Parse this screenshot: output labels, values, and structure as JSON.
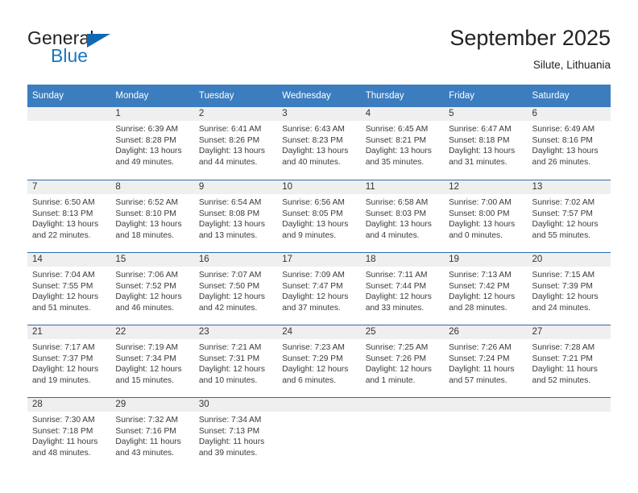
{
  "brand": {
    "name_part1": "General",
    "name_part2": "Blue",
    "triangle_icon": "triangle-icon",
    "colors": {
      "dark": "#231f20",
      "blue": "#1b75bc"
    }
  },
  "header": {
    "title": "September 2025",
    "subtitle": "Silute, Lithuania"
  },
  "theme": {
    "header_bg": "#3b7dbf",
    "row_rule": "#2b6cad",
    "daynum_band": "#efefef"
  },
  "weekdays": [
    "Sunday",
    "Monday",
    "Tuesday",
    "Wednesday",
    "Thursday",
    "Friday",
    "Saturday"
  ],
  "weeks": [
    [
      {
        "day": "",
        "blank": true,
        "sunrise": "",
        "sunset": "",
        "daylight1": "",
        "daylight2": ""
      },
      {
        "day": "1",
        "blank": false,
        "sunrise": "Sunrise: 6:39 AM",
        "sunset": "Sunset: 8:28 PM",
        "daylight1": "Daylight: 13 hours",
        "daylight2": "and 49 minutes."
      },
      {
        "day": "2",
        "blank": false,
        "sunrise": "Sunrise: 6:41 AM",
        "sunset": "Sunset: 8:26 PM",
        "daylight1": "Daylight: 13 hours",
        "daylight2": "and 44 minutes."
      },
      {
        "day": "3",
        "blank": false,
        "sunrise": "Sunrise: 6:43 AM",
        "sunset": "Sunset: 8:23 PM",
        "daylight1": "Daylight: 13 hours",
        "daylight2": "and 40 minutes."
      },
      {
        "day": "4",
        "blank": false,
        "sunrise": "Sunrise: 6:45 AM",
        "sunset": "Sunset: 8:21 PM",
        "daylight1": "Daylight: 13 hours",
        "daylight2": "and 35 minutes."
      },
      {
        "day": "5",
        "blank": false,
        "sunrise": "Sunrise: 6:47 AM",
        "sunset": "Sunset: 8:18 PM",
        "daylight1": "Daylight: 13 hours",
        "daylight2": "and 31 minutes."
      },
      {
        "day": "6",
        "blank": false,
        "sunrise": "Sunrise: 6:49 AM",
        "sunset": "Sunset: 8:16 PM",
        "daylight1": "Daylight: 13 hours",
        "daylight2": "and 26 minutes."
      }
    ],
    [
      {
        "day": "7",
        "blank": false,
        "sunrise": "Sunrise: 6:50 AM",
        "sunset": "Sunset: 8:13 PM",
        "daylight1": "Daylight: 13 hours",
        "daylight2": "and 22 minutes."
      },
      {
        "day": "8",
        "blank": false,
        "sunrise": "Sunrise: 6:52 AM",
        "sunset": "Sunset: 8:10 PM",
        "daylight1": "Daylight: 13 hours",
        "daylight2": "and 18 minutes."
      },
      {
        "day": "9",
        "blank": false,
        "sunrise": "Sunrise: 6:54 AM",
        "sunset": "Sunset: 8:08 PM",
        "daylight1": "Daylight: 13 hours",
        "daylight2": "and 13 minutes."
      },
      {
        "day": "10",
        "blank": false,
        "sunrise": "Sunrise: 6:56 AM",
        "sunset": "Sunset: 8:05 PM",
        "daylight1": "Daylight: 13 hours",
        "daylight2": "and 9 minutes."
      },
      {
        "day": "11",
        "blank": false,
        "sunrise": "Sunrise: 6:58 AM",
        "sunset": "Sunset: 8:03 PM",
        "daylight1": "Daylight: 13 hours",
        "daylight2": "and 4 minutes."
      },
      {
        "day": "12",
        "blank": false,
        "sunrise": "Sunrise: 7:00 AM",
        "sunset": "Sunset: 8:00 PM",
        "daylight1": "Daylight: 13 hours",
        "daylight2": "and 0 minutes."
      },
      {
        "day": "13",
        "blank": false,
        "sunrise": "Sunrise: 7:02 AM",
        "sunset": "Sunset: 7:57 PM",
        "daylight1": "Daylight: 12 hours",
        "daylight2": "and 55 minutes."
      }
    ],
    [
      {
        "day": "14",
        "blank": false,
        "sunrise": "Sunrise: 7:04 AM",
        "sunset": "Sunset: 7:55 PM",
        "daylight1": "Daylight: 12 hours",
        "daylight2": "and 51 minutes."
      },
      {
        "day": "15",
        "blank": false,
        "sunrise": "Sunrise: 7:06 AM",
        "sunset": "Sunset: 7:52 PM",
        "daylight1": "Daylight: 12 hours",
        "daylight2": "and 46 minutes."
      },
      {
        "day": "16",
        "blank": false,
        "sunrise": "Sunrise: 7:07 AM",
        "sunset": "Sunset: 7:50 PM",
        "daylight1": "Daylight: 12 hours",
        "daylight2": "and 42 minutes."
      },
      {
        "day": "17",
        "blank": false,
        "sunrise": "Sunrise: 7:09 AM",
        "sunset": "Sunset: 7:47 PM",
        "daylight1": "Daylight: 12 hours",
        "daylight2": "and 37 minutes."
      },
      {
        "day": "18",
        "blank": false,
        "sunrise": "Sunrise: 7:11 AM",
        "sunset": "Sunset: 7:44 PM",
        "daylight1": "Daylight: 12 hours",
        "daylight2": "and 33 minutes."
      },
      {
        "day": "19",
        "blank": false,
        "sunrise": "Sunrise: 7:13 AM",
        "sunset": "Sunset: 7:42 PM",
        "daylight1": "Daylight: 12 hours",
        "daylight2": "and 28 minutes."
      },
      {
        "day": "20",
        "blank": false,
        "sunrise": "Sunrise: 7:15 AM",
        "sunset": "Sunset: 7:39 PM",
        "daylight1": "Daylight: 12 hours",
        "daylight2": "and 24 minutes."
      }
    ],
    [
      {
        "day": "21",
        "blank": false,
        "sunrise": "Sunrise: 7:17 AM",
        "sunset": "Sunset: 7:37 PM",
        "daylight1": "Daylight: 12 hours",
        "daylight2": "and 19 minutes."
      },
      {
        "day": "22",
        "blank": false,
        "sunrise": "Sunrise: 7:19 AM",
        "sunset": "Sunset: 7:34 PM",
        "daylight1": "Daylight: 12 hours",
        "daylight2": "and 15 minutes."
      },
      {
        "day": "23",
        "blank": false,
        "sunrise": "Sunrise: 7:21 AM",
        "sunset": "Sunset: 7:31 PM",
        "daylight1": "Daylight: 12 hours",
        "daylight2": "and 10 minutes."
      },
      {
        "day": "24",
        "blank": false,
        "sunrise": "Sunrise: 7:23 AM",
        "sunset": "Sunset: 7:29 PM",
        "daylight1": "Daylight: 12 hours",
        "daylight2": "and 6 minutes."
      },
      {
        "day": "25",
        "blank": false,
        "sunrise": "Sunrise: 7:25 AM",
        "sunset": "Sunset: 7:26 PM",
        "daylight1": "Daylight: 12 hours",
        "daylight2": "and 1 minute."
      },
      {
        "day": "26",
        "blank": false,
        "sunrise": "Sunrise: 7:26 AM",
        "sunset": "Sunset: 7:24 PM",
        "daylight1": "Daylight: 11 hours",
        "daylight2": "and 57 minutes."
      },
      {
        "day": "27",
        "blank": false,
        "sunrise": "Sunrise: 7:28 AM",
        "sunset": "Sunset: 7:21 PM",
        "daylight1": "Daylight: 11 hours",
        "daylight2": "and 52 minutes."
      }
    ],
    [
      {
        "day": "28",
        "blank": false,
        "sunrise": "Sunrise: 7:30 AM",
        "sunset": "Sunset: 7:18 PM",
        "daylight1": "Daylight: 11 hours",
        "daylight2": "and 48 minutes."
      },
      {
        "day": "29",
        "blank": false,
        "sunrise": "Sunrise: 7:32 AM",
        "sunset": "Sunset: 7:16 PM",
        "daylight1": "Daylight: 11 hours",
        "daylight2": "and 43 minutes."
      },
      {
        "day": "30",
        "blank": false,
        "sunrise": "Sunrise: 7:34 AM",
        "sunset": "Sunset: 7:13 PM",
        "daylight1": "Daylight: 11 hours",
        "daylight2": "and 39 minutes."
      },
      {
        "day": "",
        "blank": true,
        "sunrise": "",
        "sunset": "",
        "daylight1": "",
        "daylight2": ""
      },
      {
        "day": "",
        "blank": true,
        "sunrise": "",
        "sunset": "",
        "daylight1": "",
        "daylight2": ""
      },
      {
        "day": "",
        "blank": true,
        "sunrise": "",
        "sunset": "",
        "daylight1": "",
        "daylight2": ""
      },
      {
        "day": "",
        "blank": true,
        "sunrise": "",
        "sunset": "",
        "daylight1": "",
        "daylight2": ""
      }
    ]
  ]
}
